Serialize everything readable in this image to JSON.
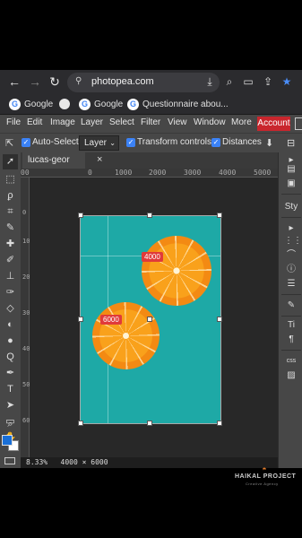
{
  "browser": {
    "url": "photopea.com",
    "back_icon": "arrow-left-icon",
    "forward_icon": "arrow-right-icon",
    "reload_icon": "reload-icon"
  },
  "bookmarks": {
    "items": [
      {
        "label": "Google",
        "icon": "G"
      },
      {
        "label": "Google",
        "icon": "G"
      },
      {
        "label": "Questionnaire abou...",
        "icon": "G"
      }
    ]
  },
  "menubar": {
    "items": [
      "File",
      "Edit",
      "Image",
      "Layer",
      "Select",
      "Filter",
      "View",
      "Window",
      "More"
    ],
    "account_label": "Account"
  },
  "options": {
    "auto_select_label": "Auto-Select",
    "auto_select_checked": true,
    "layer_select_value": "Layer",
    "transform_controls_label": "Transform controls",
    "transform_controls_checked": true,
    "distances_label": "Distances",
    "distances_checked": true
  },
  "document": {
    "tab_label": "lucas-geor",
    "close_label": "×",
    "zoom": "8.33%",
    "dimensions": "4000 × 6000",
    "width_badge": "4000",
    "height_badge": "6000"
  },
  "rulers": {
    "top": [
      "00",
      "0",
      "1000",
      "2000",
      "3000",
      "4000",
      "5000"
    ],
    "left": [
      "0",
      "1000",
      "2000",
      "3000",
      "4000",
      "5000",
      "6000"
    ]
  },
  "colors": {
    "foreground": "#1a6fd6",
    "background": "#ffffff",
    "account": "#c9262d",
    "canvas_teal": "#1ea9a6"
  },
  "right_panel": {
    "style_label": "Sty",
    "css_label": "css"
  },
  "watermark": {
    "title": "HAIKAL PROJECT",
    "subtitle": "Creative Agency"
  }
}
